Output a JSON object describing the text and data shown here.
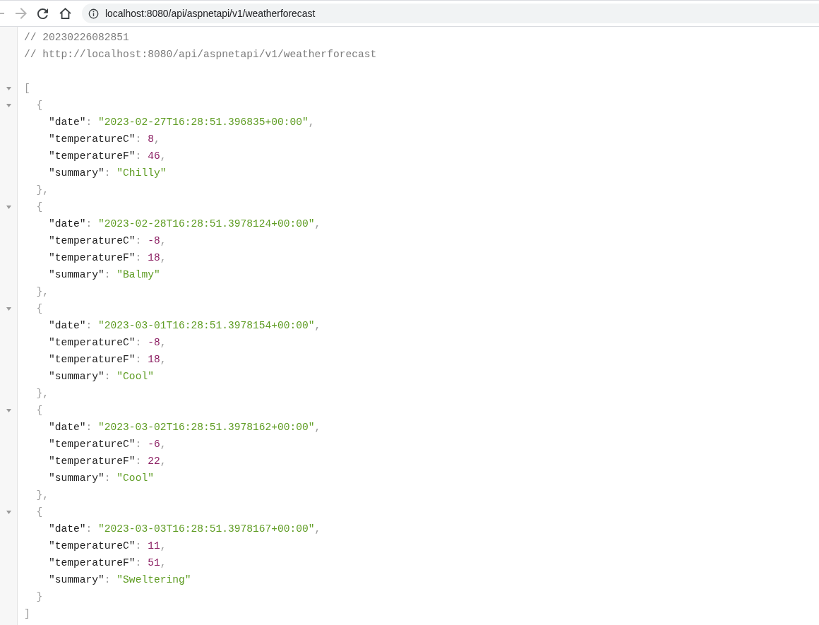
{
  "toolbar": {
    "nav_buttons": [
      {
        "kind": "back",
        "disabled": true
      },
      {
        "kind": "forward",
        "disabled": true
      },
      {
        "kind": "reload",
        "disabled": false
      },
      {
        "kind": "home",
        "disabled": false
      }
    ],
    "address_bar": {
      "url": "localhost:8080/api/aspnetapi/v1/weatherforecast"
    }
  },
  "viewer": {
    "comments": [
      "// 20230226082851",
      "// http://localhost:8080/api/aspnetapi/v1/weatherforecast"
    ],
    "root": {
      "expanded": true,
      "open": "[",
      "close": "]",
      "children": [
        {
          "expanded": true,
          "open": "{",
          "close": "},",
          "fields": [
            {
              "key": "\"date\"",
              "colon": ":",
              "value": "\"2023-02-27T16:28:51.396835+00:00\"",
              "kind": "string",
              "comma": ","
            },
            {
              "key": "\"temperatureC\"",
              "colon": ":",
              "value": "8",
              "kind": "number",
              "comma": ","
            },
            {
              "key": "\"temperatureF\"",
              "colon": ":",
              "value": "46",
              "kind": "number",
              "comma": ","
            },
            {
              "key": "\"summary\"",
              "colon": ":",
              "value": "\"Chilly\"",
              "kind": "string"
            }
          ]
        },
        {
          "expanded": true,
          "open": "{",
          "close": "},",
          "fields": [
            {
              "key": "\"date\"",
              "colon": ":",
              "value": "\"2023-02-28T16:28:51.3978124+00:00\"",
              "kind": "string",
              "comma": ","
            },
            {
              "key": "\"temperatureC\"",
              "colon": ":",
              "value": "-8",
              "kind": "number",
              "comma": ","
            },
            {
              "key": "\"temperatureF\"",
              "colon": ":",
              "value": "18",
              "kind": "number",
              "comma": ","
            },
            {
              "key": "\"summary\"",
              "colon": ":",
              "value": "\"Balmy\"",
              "kind": "string"
            }
          ]
        },
        {
          "expanded": true,
          "open": "{",
          "close": "},",
          "fields": [
            {
              "key": "\"date\"",
              "colon": ":",
              "value": "\"2023-03-01T16:28:51.3978154+00:00\"",
              "kind": "string",
              "comma": ","
            },
            {
              "key": "\"temperatureC\"",
              "colon": ":",
              "value": "-8",
              "kind": "number",
              "comma": ","
            },
            {
              "key": "\"temperatureF\"",
              "colon": ":",
              "value": "18",
              "kind": "number",
              "comma": ","
            },
            {
              "key": "\"summary\"",
              "colon": ":",
              "value": "\"Cool\"",
              "kind": "string"
            }
          ]
        },
        {
          "expanded": true,
          "open": "{",
          "close": "},",
          "fields": [
            {
              "key": "\"date\"",
              "colon": ":",
              "value": "\"2023-03-02T16:28:51.3978162+00:00\"",
              "kind": "string",
              "comma": ","
            },
            {
              "key": "\"temperatureC\"",
              "colon": ":",
              "value": "-6",
              "kind": "number",
              "comma": ","
            },
            {
              "key": "\"temperatureF\"",
              "colon": ":",
              "value": "22",
              "kind": "number",
              "comma": ","
            },
            {
              "key": "\"summary\"",
              "colon": ":",
              "value": "\"Cool\"",
              "kind": "string"
            }
          ]
        },
        {
          "expanded": true,
          "open": "{",
          "close": "}",
          "fields": [
            {
              "key": "\"date\"",
              "colon": ":",
              "value": "\"2023-03-03T16:28:51.3978167+00:00\"",
              "kind": "string",
              "comma": ","
            },
            {
              "key": "\"temperatureC\"",
              "colon": ":",
              "value": "11",
              "kind": "number",
              "comma": ","
            },
            {
              "key": "\"temperatureF\"",
              "colon": ":",
              "value": "51",
              "kind": "number",
              "comma": ","
            },
            {
              "key": "\"summary\"",
              "colon": ":",
              "value": "\"Sweltering\"",
              "kind": "string"
            }
          ]
        }
      ]
    }
  }
}
